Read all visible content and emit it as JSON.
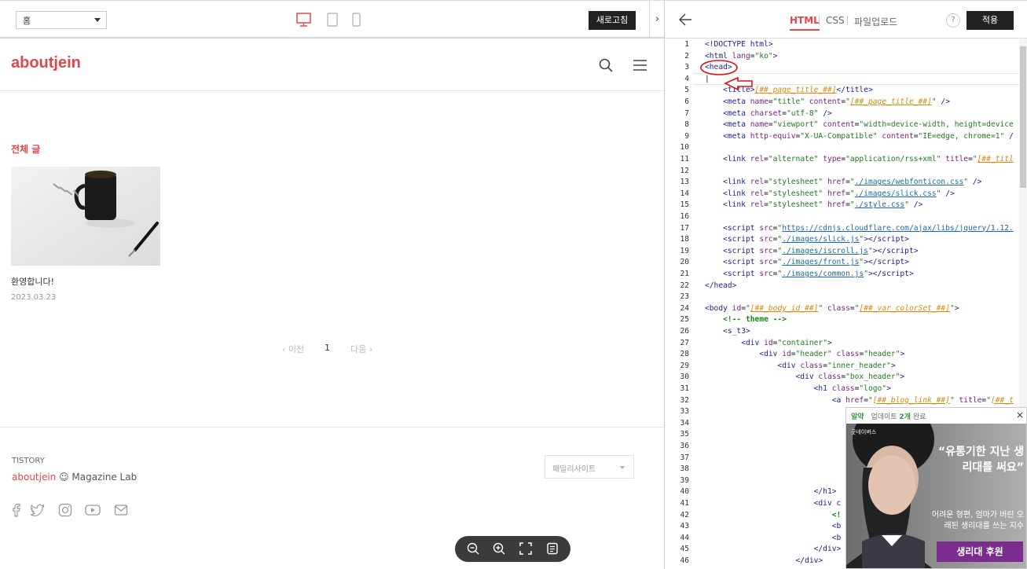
{
  "preview": {
    "skin_select": "홈",
    "refresh_label": "새로고침",
    "collapse_glyph": "›"
  },
  "blog": {
    "logo": "aboutjein",
    "category_title": "전체 글",
    "post": {
      "title": "환영합니다!",
      "date": "2023.03.23"
    },
    "pager": {
      "prev": "‹ 이전",
      "current": "1",
      "next": "다음 ›"
    },
    "footer": {
      "brand": "TISTORY",
      "name": "aboutjein",
      "tagline": " ☺ Magazine Lab",
      "family_site": "패밀리사이트"
    }
  },
  "editor": {
    "tabs": {
      "html": "HTML",
      "css": "CSS",
      "upload": "파일업로드"
    },
    "help": "?",
    "apply_label": "적용",
    "line_numbers": [
      "1",
      "2",
      "3",
      "4",
      "5",
      "6",
      "7",
      "8",
      "9",
      "10",
      "11",
      "12",
      "13",
      "14",
      "15",
      "16",
      "17",
      "18",
      "19",
      "20",
      "21",
      "22",
      "23",
      "24",
      "25",
      "26",
      "27",
      "28",
      "29",
      "30",
      "31",
      "32",
      "33",
      "34",
      "35",
      "36",
      "37",
      "38",
      "39",
      "40",
      "41",
      "42",
      "43",
      "44",
      "45",
      "46"
    ]
  },
  "ad": {
    "app_name": "알약",
    "status_prefix": "업데이트 ",
    "status_count": "2개",
    "status_suffix": " 완료",
    "close": "×",
    "brand": "굿네이버스",
    "headline": "“유통기한 지난 생리대를 써요”",
    "sub": "어려운 형편, 엄마가 버린 오래된 생리대를 쓰는 지수",
    "cta": "생리대 후원"
  },
  "colors": {
    "accent": "#e0464b",
    "dark_button": "#222222",
    "ad_cta": "#7b2d8e"
  }
}
